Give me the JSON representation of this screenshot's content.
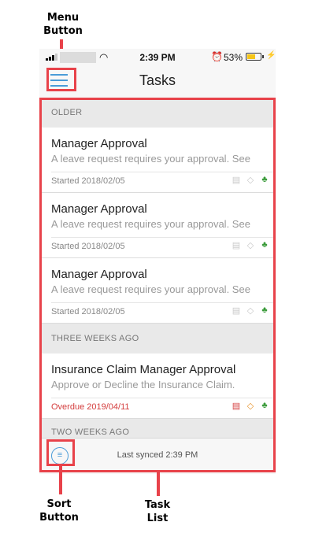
{
  "annotations": {
    "menu_button": [
      "Menu",
      "Button"
    ],
    "sort_button": [
      "Sort",
      "Button"
    ],
    "task_list": [
      "Task",
      "List"
    ]
  },
  "status_bar": {
    "time": "2:39 PM",
    "battery_percent": "53%",
    "battery_level": 0.53,
    "icons": [
      "signal-icon",
      "wifi-icon",
      "alarm-icon",
      "battery-icon",
      "charging-icon"
    ]
  },
  "nav": {
    "title": "Tasks",
    "menu_icon": "hamburger-menu-icon"
  },
  "sections": [
    {
      "header": "OLDER",
      "tasks": [
        {
          "title": "Manager Approval",
          "description": "A leave request requires your approval. See",
          "date": "Started 2018/02/05",
          "overdue": false
        },
        {
          "title": "Manager Approval",
          "description": "A leave request requires your approval. See",
          "date": "Started 2018/02/05",
          "overdue": false
        },
        {
          "title": "Manager Approval",
          "description": "A leave request requires your approval. See",
          "date": "Started 2018/02/05",
          "overdue": false
        }
      ]
    },
    {
      "header": "THREE WEEKS AGO",
      "tasks": [
        {
          "title": "Insurance Claim Manager Approval",
          "description": "Approve or Decline the Insurance Claim.",
          "date": "Overdue 2019/04/11",
          "overdue": true
        }
      ]
    },
    {
      "header": "TWO WEEKS AGO",
      "tasks": []
    }
  ],
  "task_icons": [
    "calendar-icon",
    "priority-icon",
    "process-tree-icon"
  ],
  "footer": {
    "sync_status": "Last synced 2:39 PM",
    "sort_icon": "sort-icon"
  },
  "colors": {
    "annotation_red": "#e8424a",
    "accent_blue": "#4a9cd8",
    "overdue_red": "#d43d3d",
    "priority_orange": "#e8922a",
    "tree_green": "#3a9b3a"
  }
}
